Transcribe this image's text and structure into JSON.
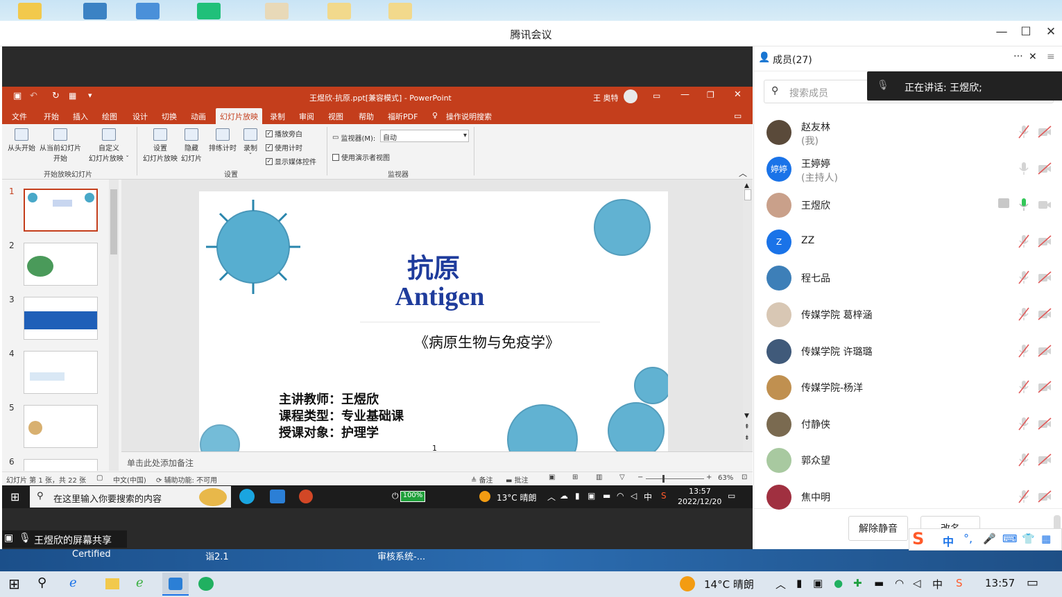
{
  "window": {
    "title": "腾讯会议"
  },
  "ppt": {
    "title": "王煜欣-抗原.ppt[兼容模式] - PowerPoint",
    "user": "王 奥特",
    "tabs": [
      "文件",
      "开始",
      "插入",
      "绘图",
      "设计",
      "切换",
      "动画",
      "幻灯片放映",
      "录制",
      "审阅",
      "视图",
      "帮助",
      "福昕PDF",
      "操作说明搜索"
    ],
    "active_tab": "幻灯片放映",
    "ribbon": {
      "from_start": "从头开始",
      "from_current_1": "从当前幻灯片",
      "from_current_2": "开始",
      "custom_1": "自定义",
      "custom_2": "幻灯片放映 ˇ",
      "group_start": "开始放映幻灯片",
      "setup_1": "设置",
      "setup_2": "幻灯片放映",
      "hide_1": "隐藏",
      "hide_2": "幻灯片",
      "rehearse": "排练计时",
      "record": "录制",
      "record_2": "ˇ",
      "narration": "播放旁白",
      "timings": "使用计时",
      "media": "显示媒体控件",
      "group_setup": "设置",
      "monitor_label": "监视器(M):",
      "monitor_value": "自动",
      "presenter_view": "使用演示者视图",
      "group_monitor": "监视器"
    },
    "slides": [
      "1",
      "2",
      "3",
      "4",
      "5",
      "6"
    ],
    "slide": {
      "title_cn": "抗原",
      "title_en": "Antigen",
      "course": "《病原生物与免疫学》",
      "line1": "主讲教师：王煜欣",
      "line2": "课程类型：专业基础课",
      "line3": "授课对象：护理学",
      "page": "1"
    },
    "notes_placeholder": "单击此处添加备注",
    "status": {
      "slide_info": "幻灯片 第 1 张，共 22 张",
      "language": "中文(中国)",
      "accessibility": "辅助功能: 不可用",
      "notes": "备注",
      "comments": "批注",
      "zoom": "63%"
    }
  },
  "inner_taskbar": {
    "search_placeholder": "在这里输入你要搜索的内容",
    "battery": "100%",
    "weather": "13°C  晴朗",
    "ime": "中",
    "time": "13:57",
    "date": "2022/12/20"
  },
  "share_label": "王煜欣的屏幕共享",
  "desktop_labels": [
    "Certified",
    "诣2.1",
    "审核系统-..."
  ],
  "taskbar": {
    "weather": "14°C  晴朗",
    "ime": "中",
    "time": "13:57"
  },
  "panel": {
    "members_title": "成员(27)",
    "search_placeholder": "搜索成员",
    "speaking": "正在讲话: 王煜欣;",
    "members": [
      {
        "name": "赵友林",
        "sub": "(我)",
        "avatar": "",
        "color": "#5a4a3a"
      },
      {
        "name": "王婷婷",
        "sub": "(主持人)",
        "avatar": "婷婷",
        "color": "#1a73e8"
      },
      {
        "name": "王煜欣",
        "sub": "",
        "avatar": "",
        "color": "#c9a08a"
      },
      {
        "name": "ZZ",
        "sub": "",
        "avatar": "Z",
        "color": "#1a73e8"
      },
      {
        "name": "程七品",
        "sub": "",
        "avatar": "",
        "color": "#3d7fb8"
      },
      {
        "name": "传媒学院 葛梓涵",
        "sub": "",
        "avatar": "",
        "color": "#d8c7b4"
      },
      {
        "name": "传媒学院 许璐璐",
        "sub": "",
        "avatar": "",
        "color": "#405a7a"
      },
      {
        "name": "传媒学院-杨洋",
        "sub": "",
        "avatar": "",
        "color": "#c09050"
      },
      {
        "name": "付静侠",
        "sub": "",
        "avatar": "",
        "color": "#7a6a50"
      },
      {
        "name": "郭众望",
        "sub": "",
        "avatar": "",
        "color": "#a8c9a0"
      },
      {
        "name": "焦中明",
        "sub": "",
        "avatar": "",
        "color": "#a03040"
      }
    ],
    "unmute_button": "解除静音",
    "rename_button": "改名"
  },
  "ime_bar": {
    "label": "中"
  },
  "colors": {
    "ppt_accent": "#c43e1c",
    "meeting_blue": "#1a73e8",
    "slide_title": "#1f3c9c"
  }
}
